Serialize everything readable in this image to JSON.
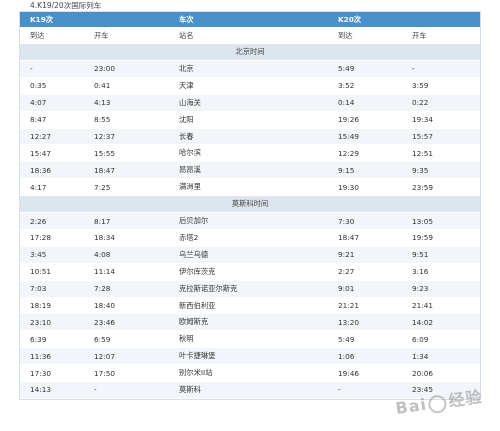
{
  "caption": "4.K19/20次国际列车",
  "header": {
    "k19_label": "K19次",
    "mid_label": "车次",
    "k20_label": "K20次"
  },
  "subheader": {
    "arrive1": "到达",
    "depart1": "开车",
    "station": "站名",
    "arrive2": "到达",
    "depart2": "开车"
  },
  "sections": [
    {
      "title": "北京时间",
      "rows": [
        [
          "-",
          "23:00",
          "北京",
          "5:49",
          "-"
        ],
        [
          "0:35",
          "0:41",
          "天津",
          "3:52",
          "3:59"
        ],
        [
          "4:07",
          "4:13",
          "山海关",
          "0:14",
          "0:22"
        ],
        [
          "8:47",
          "8:55",
          "沈阳",
          "19:26",
          "19:34"
        ],
        [
          "12:27",
          "12:37",
          "长春",
          "15:49",
          "15:57"
        ],
        [
          "15:47",
          "15:55",
          "哈尔滨",
          "12:29",
          "12:51"
        ],
        [
          "18:36",
          "18:47",
          "昂昂溪",
          "9:15",
          "9:35"
        ],
        [
          "4:17",
          "7:25",
          "满洲里",
          "19:30",
          "23:59"
        ]
      ]
    },
    {
      "title": "莫斯科时间",
      "rows": [
        [
          "2:26",
          "8:17",
          "后贝加尔",
          "7:30",
          "13:05"
        ],
        [
          "17:28",
          "18:34",
          "赤塔2",
          "18:47",
          "19:59"
        ],
        [
          "3:45",
          "4:08",
          "乌兰乌德",
          "9:21",
          "9:51"
        ],
        [
          "10:51",
          "11:14",
          "伊尔库茨克",
          "2:27",
          "3:16"
        ],
        [
          "7:03",
          "7:28",
          "克拉斯诺亚尔斯克",
          "9:01",
          "9:23"
        ],
        [
          "18:19",
          "18:40",
          "新西伯利亚",
          "21:21",
          "21:41"
        ],
        [
          "23:10",
          "23:46",
          "欧姆斯克",
          "13:20",
          "14:02"
        ],
        [
          "6:39",
          "6:59",
          "秋明",
          "5:49",
          "6:09"
        ],
        [
          "11:36",
          "12:07",
          "叶卡捷琳堡",
          "1:06",
          "1:34"
        ],
        [
          "17:30",
          "17:50",
          "别尔米II站",
          "19:46",
          "20:06"
        ],
        [
          "14:13",
          "-",
          "莫斯科",
          "-",
          "23:45"
        ]
      ]
    }
  ],
  "watermark": "Bai du 经验"
}
